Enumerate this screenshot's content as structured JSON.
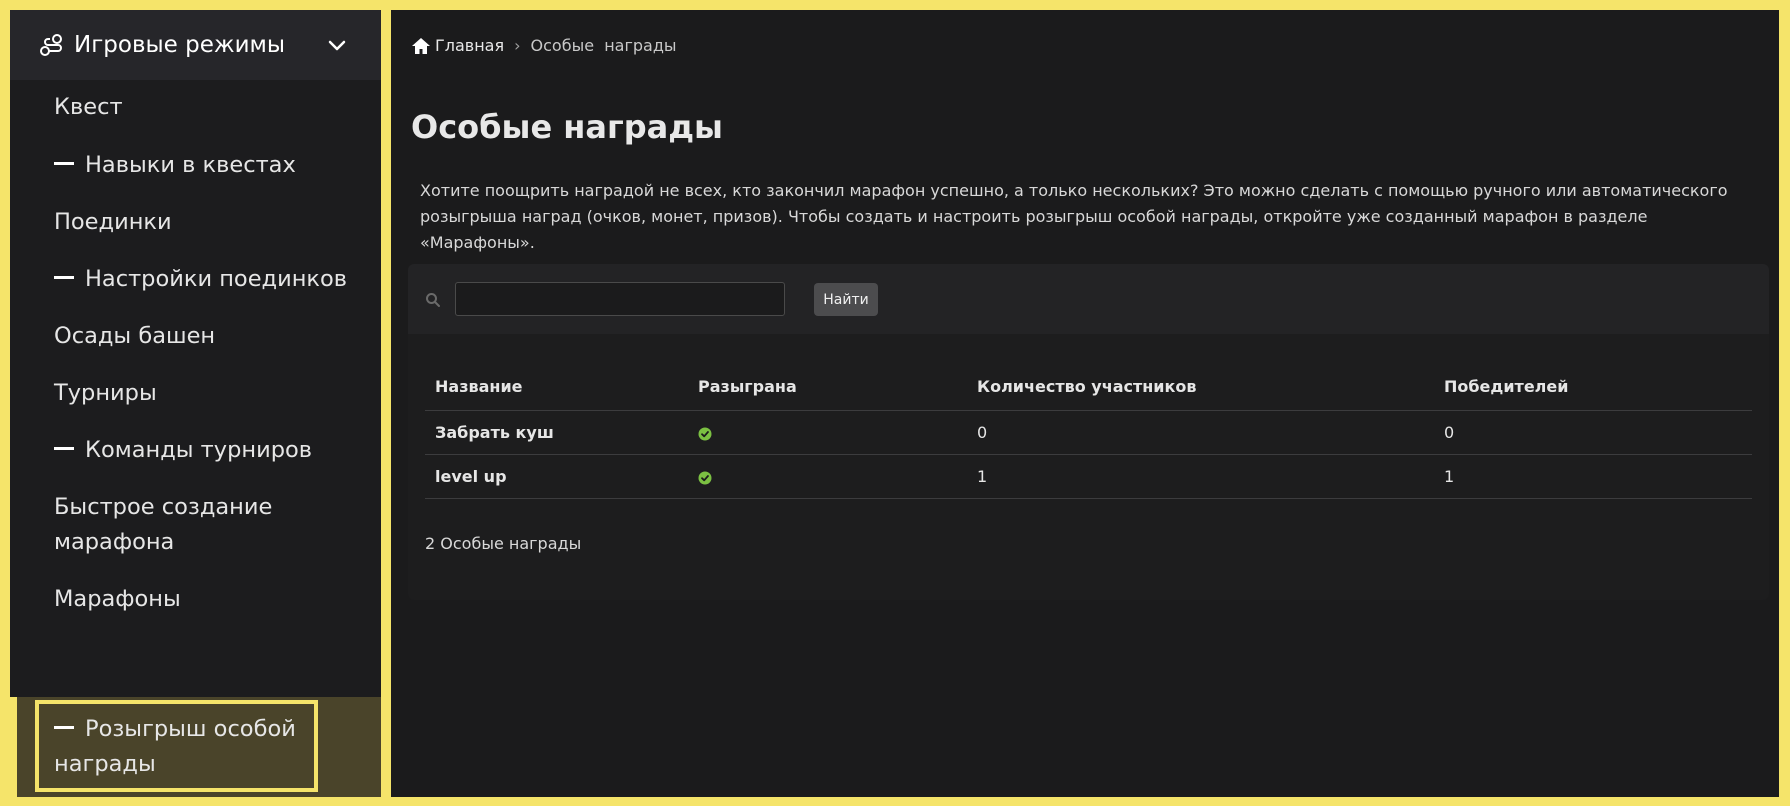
{
  "sidebar": {
    "header": {
      "label": "Игровые режимы",
      "icon": "game-modes-icon",
      "chevron": "chevron-down-icon"
    },
    "items": [
      {
        "label": "Квест",
        "sub": false
      },
      {
        "label": "Навыки в квестах",
        "sub": true
      },
      {
        "label": "Поединки",
        "sub": false
      },
      {
        "label": "Настройки поединков",
        "sub": true
      },
      {
        "label": "Осады башен",
        "sub": false
      },
      {
        "label": "Турниры",
        "sub": false
      },
      {
        "label": "Команды турниров",
        "sub": true
      },
      {
        "label": "Быстрое создание марафона",
        "sub": false
      },
      {
        "label": "Марафоны",
        "sub": false
      }
    ],
    "active_item": {
      "label": "Розыгрыш особой награды",
      "sub": true
    }
  },
  "breadcrumb": {
    "home": "Главная",
    "separator": "›",
    "current": "Особые  награды"
  },
  "page": {
    "title": "Особые награды",
    "description": "Хотите поощрить наградой не всех, кто закончил марафон успешно, а только нескольких? Это можно сделать с помощью ручного или автоматического розыгрыша наград (очков, монет, призов). Чтобы создать и настроить розыгрыш особой награды, откройте уже созданный марафон в разделе «Марафоны»."
  },
  "search": {
    "value": "",
    "placeholder": "",
    "button_label": "Найти"
  },
  "table": {
    "headers": [
      "Название",
      "Разыграна",
      "Количество участников",
      "Победителей"
    ],
    "rows": [
      {
        "name": "Забрать куш",
        "drawn": true,
        "participants": "0",
        "winners": "0"
      },
      {
        "name": "level up",
        "drawn": true,
        "participants": "1",
        "winners": "1"
      }
    ],
    "count_label": "2 Особые награды"
  },
  "colors": {
    "accent_highlight": "#f5e46a",
    "check_green": "#7bc042",
    "sidebar_bg": "#1c1c1e",
    "main_bg": "#1b1b1c"
  }
}
